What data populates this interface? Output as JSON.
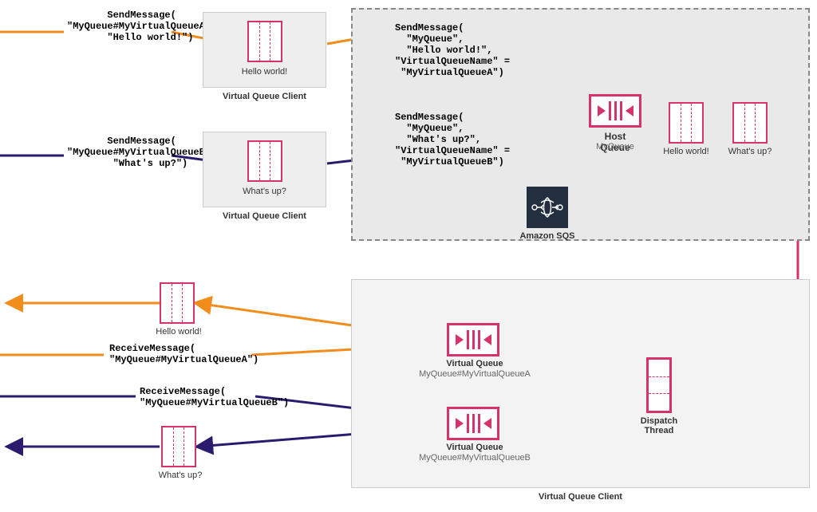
{
  "top": {
    "sendA": "SendMessage(\n\"MyQueue#MyVirtualQueueA\",\n   \"Hello world!\")",
    "sendB": "SendMessage(\n\"MyQueue#MyVirtualQueueB\",\n   \"What's up?\")",
    "clientA_msg": "Hello world!",
    "clientB_msg": "What's up?",
    "client_label": "Virtual Queue Client",
    "innerSendA": "SendMessage(\n  \"MyQueue\",\n  \"Hello world!\",\n\"VirtualQueueName\" =\n \"MyVirtualQueueA\")",
    "innerSendB": "SendMessage(\n  \"MyQueue\",\n  \"What's up?\",\n\"VirtualQueueName\" =\n \"MyVirtualQueueB\")",
    "host_label": "Host Queue",
    "host_sub": "MyQueue",
    "msg1": "Hello world!",
    "msg2": "What's up?",
    "sqs_label": "Amazon SQS"
  },
  "bottom": {
    "recvA": "ReceiveMessage(\n\"MyQueue#MyVirtualQueueA\")",
    "recvB": "ReceiveMessage(\n\"MyQueue#MyVirtualQueueB\")",
    "msgA": "Hello world!",
    "msgB": "What's up?",
    "vq_label": "Virtual Queue",
    "vqA_sub": "MyQueue#MyVirtualQueueA",
    "vqB_sub": "MyQueue#MyVirtualQueueB",
    "dispatch_label": "Dispatch\nThread",
    "big_label": "Virtual Queue Client"
  },
  "colors": {
    "orange": "#f28c1b",
    "navy": "#2a1b6e",
    "pink": "#d6336c"
  }
}
